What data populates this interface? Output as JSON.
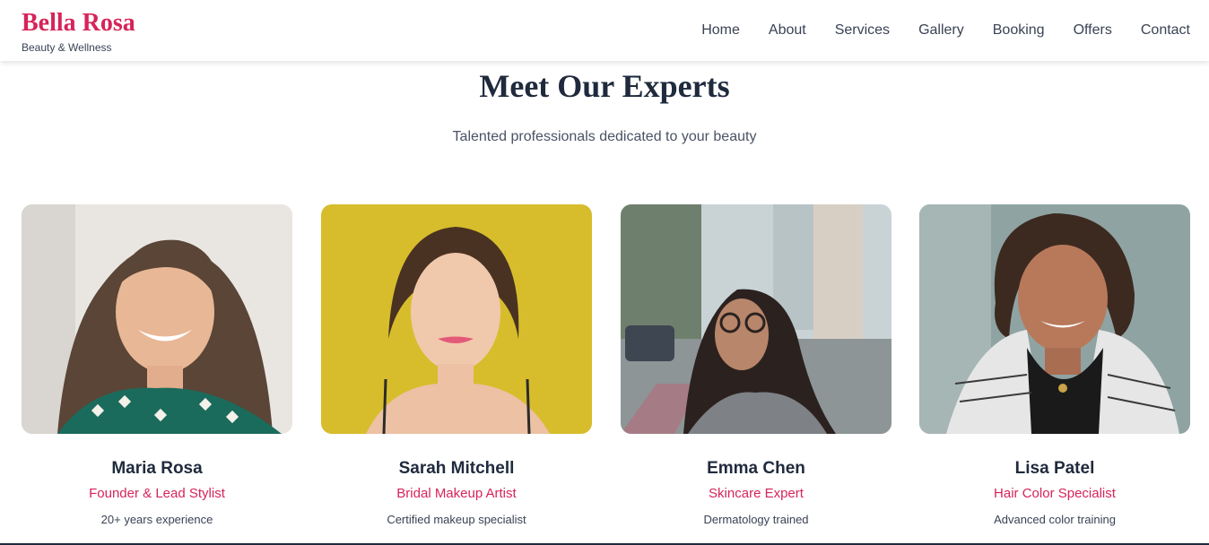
{
  "brand": {
    "name": "Bella Rosa",
    "tagline": "Beauty & Wellness"
  },
  "nav": [
    {
      "label": "Home"
    },
    {
      "label": "About"
    },
    {
      "label": "Services"
    },
    {
      "label": "Gallery"
    },
    {
      "label": "Booking"
    },
    {
      "label": "Offers"
    },
    {
      "label": "Contact"
    }
  ],
  "section": {
    "title": "Meet Our Experts",
    "subtitle": "Talented professionals dedicated to your beauty"
  },
  "experts": [
    {
      "name": "Maria Rosa",
      "role": "Founder & Lead Stylist",
      "detail": "20+ years experience"
    },
    {
      "name": "Sarah Mitchell",
      "role": "Bridal Makeup Artist",
      "detail": "Certified makeup specialist"
    },
    {
      "name": "Emma Chen",
      "role": "Skincare Expert",
      "detail": "Dermatology trained"
    },
    {
      "name": "Lisa Patel",
      "role": "Hair Color Specialist",
      "detail": "Advanced color training"
    }
  ],
  "colors": {
    "accent": "#d6245a",
    "text": "#1f2a3d",
    "muted": "#3a4254"
  }
}
